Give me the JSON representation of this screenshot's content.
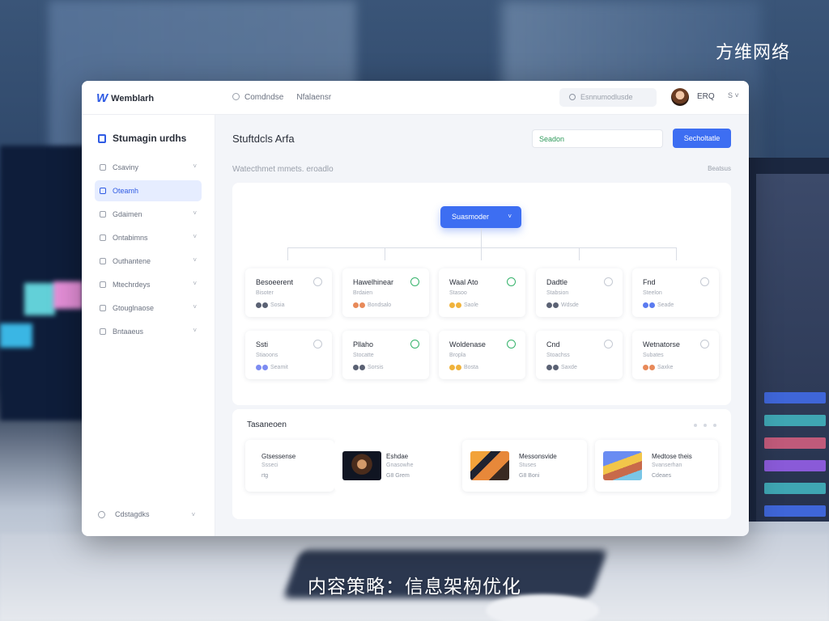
{
  "overlay": {
    "brand": "方维网络",
    "caption": "内容策略：信息架构优化"
  },
  "app": {
    "logo_mark": "W",
    "logo_text": "Wemblarh",
    "nav": [
      "Comdndse",
      "Nfalaensr"
    ],
    "search_placeholder": "Esnnumodlusde",
    "user_name": "ERQ",
    "user_caret": "S ˅"
  },
  "sidebar": {
    "title": "Stumagin urdhs",
    "items": [
      {
        "label": "Csaviny"
      },
      {
        "label": "Oteamh"
      },
      {
        "label": "Gdaimen"
      },
      {
        "label": "Ontabimns"
      },
      {
        "label": "Outhantene"
      },
      {
        "label": "Mtechrdeys"
      },
      {
        "label": "Gtouglnaose"
      },
      {
        "label": "Bntaaeus"
      }
    ],
    "footer": "Cdstagdks"
  },
  "main": {
    "title": "Stuftdcls Arfa",
    "filter_value": "Seadon",
    "primary_button": "Secholtatle",
    "sub_label": "Watecthmet mmets. eroadlo",
    "sub_right": "Beatsus",
    "root_node": "Suasmoder",
    "cards": [
      {
        "title": "Besoeerent",
        "sub": "Bisoter",
        "meta": "Sosia",
        "check": "circle",
        "colors": [
          "#5b6274",
          "#5b6274"
        ]
      },
      {
        "title": "Hawelhinear",
        "sub": "Brdaien",
        "meta": "Bondsalo",
        "check": "green",
        "colors": [
          "#e88a5a",
          "#e88a5a"
        ]
      },
      {
        "title": "Waal Ato",
        "sub": "Stasoo",
        "meta": "Saole",
        "check": "green",
        "colors": [
          "#f0b33c",
          "#f0b33c"
        ]
      },
      {
        "title": "Dadtle",
        "sub": "Stabsion",
        "meta": "Wdsde",
        "check": "circle",
        "colors": [
          "#5b6274",
          "#5b6274"
        ]
      },
      {
        "title": "Fnd",
        "sub": "Steelon",
        "meta": "Seade",
        "check": "circle",
        "colors": [
          "#5b7bf0",
          "#5b7bf0"
        ]
      },
      {
        "title": "Ssti",
        "sub": "Stiaoons",
        "meta": "Seamit",
        "check": "circle",
        "colors": [
          "#7d8cf2",
          "#7d8cf2"
        ]
      },
      {
        "title": "Pllaho",
        "sub": "Stocatte",
        "meta": "Sorsis",
        "check": "green",
        "colors": [
          "#5b6274",
          "#5b6274"
        ]
      },
      {
        "title": "Woldenase",
        "sub": "Bropla",
        "meta": "Bosta",
        "check": "green",
        "colors": [
          "#f0b33c",
          "#f0b33c"
        ]
      },
      {
        "title": "Cnd",
        "sub": "Stoachss",
        "meta": "Saxde",
        "check": "circle",
        "colors": [
          "#5b6274",
          "#5b6274"
        ]
      },
      {
        "title": "Wetnatorse",
        "sub": "Subates",
        "meta": "Saxke",
        "check": "circle",
        "colors": [
          "#e88a5a",
          "#e88a5a"
        ]
      }
    ],
    "lower_title": "Tasaneoen",
    "resources": [
      {
        "title": "Gtsessense",
        "sub": "Ssseci",
        "meta": "rtg",
        "thumb": "none"
      },
      {
        "title": "Eshdae",
        "sub": "Gnasowhe",
        "meta": "G8 Grem",
        "thumb": "dark-portrait"
      },
      {
        "title": "Messonsvide",
        "sub": "Stuses",
        "meta": "G8 Boni",
        "thumb": "abstract-orange"
      },
      {
        "title": "Medtose theis",
        "sub": "Svanserhan",
        "meta": "Cdeaes",
        "thumb": "abstract-blue"
      }
    ]
  }
}
